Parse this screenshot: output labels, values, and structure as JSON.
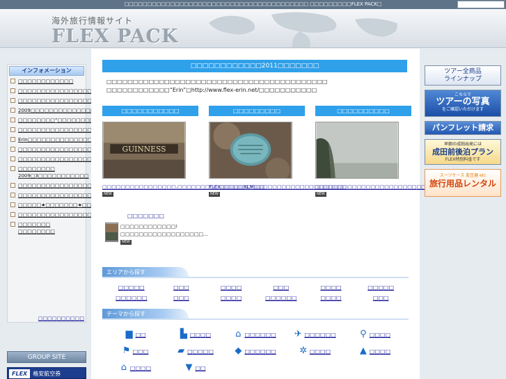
{
  "topbar": {
    "text": "□□□□□□□□□□□□□□□□□□□□□□□□□□□□□□□□□□□□□□□□ □□□□□□□□□FLEX PACK□"
  },
  "header": {
    "site_subtitle": "海外旅行情報サイト",
    "brand": "FLEX PACK"
  },
  "sidebar": {
    "title": "インフォメーション",
    "items": [
      "□□□□□□□□□□□□",
      "□□□□□□□□□□□□□□□□□□□□□□□□□□□□□□□□□VJF□□□□□",
      "□□□□□□□□□□□□□□□□",
      "2009□□□□□□□□□□□□□□□□□□",
      "□□□□□□□□“□□□□□□□□□□”□□□□",
      "□□□□□□□□□□□□□□□□□□□□□",
      "Erin□□□□□□□□□□□□□□□□",
      "□□□□□□□□□□□□□□□□",
      "□□□□□□□□□□□□□□□□□□□□□□□□□□□□□□□□□□□□□",
      "□□□□□□□□ 2009□3□□□□□□□□□□□",
      "□□□□□□□□□□□□□□□□□□□□□",
      "□□□□□□□□□□□□□□□□□□",
      "□□□□□★□□□□□□□★□□□□□□□□□□□2008□□□□",
      "□□□□□□□□□□□□□□□□□□□□",
      "□□□□□□□ □□□□□□□□"
    ],
    "more": "□□□□□□□□□□",
    "group_site": "GROUP SITE",
    "flex_logo": "FLEX",
    "flex_banner": "格安航空券"
  },
  "main": {
    "news_title": "□□□□□□□□□□□□2011□□□□□□□",
    "news_text": "□□□□□□□□□□□□□□□□□□□□□□□□□□□□□□□□□□□□□□□□□□ □□□□□□□□□□□□“Erin”□http://www.flex-erin.net/□□□□□□□□□□□",
    "cards": [
      {
        "head": "□□□□□□□□□□□",
        "text": "□□□□□□□□□□□□□□□□,□□□□□□□□□□□□□□□□□□□_",
        "badge": "NEW"
      },
      {
        "head": "□□□□□□□□□",
        "text": "FLEX□□□□□KLM□□□□□□□□□□□□□□□□□□□□_",
        "badge": "NEW"
      },
      {
        "head": "□□□□□□□□□□",
        "text": "□□□□□□□□□□□□□□□□□□□□□□□□□□□□□□□□□_",
        "badge": "NEW"
      }
    ],
    "mini_head": "□□□□□□□",
    "mini_text": "□□□□□□□□□□□□! □□□□□□□□□□□□□□□□□□...",
    "mini_badge": "NEW",
    "area_title": "エリアから探す",
    "areas": [
      "□□□□□",
      "□□□",
      "□□□□",
      "□□□",
      "□□□□",
      "□□□□□",
      "□□□□□□",
      "□□□",
      "□□□□",
      "□□□□□□",
      "□□□□",
      "□□□"
    ],
    "theme_title": "テーマから探す",
    "themes": [
      {
        "icon": "suitcase-icon",
        "glyph": "▆",
        "label": "□□"
      },
      {
        "icon": "city-icon",
        "glyph": "▙",
        "label": "□□□□"
      },
      {
        "icon": "house-icon",
        "glyph": "⌂",
        "label": "□□□□□□"
      },
      {
        "icon": "plane-icon",
        "glyph": "✈",
        "label": "□□□□□□"
      },
      {
        "icon": "dining-icon",
        "glyph": "⚲",
        "label": "□□□□"
      },
      {
        "icon": "shopping-icon",
        "glyph": "⚑",
        "label": "□□□"
      },
      {
        "icon": "elephant-icon",
        "glyph": "▰",
        "label": "□□□□□"
      },
      {
        "icon": "fish-icon",
        "glyph": "◆",
        "label": "□□□□□□"
      },
      {
        "icon": "esthe-icon",
        "glyph": "✲",
        "label": "□□□□"
      },
      {
        "icon": "mountain-icon",
        "glyph": "▲",
        "label": "□□□□"
      },
      {
        "icon": "church-icon",
        "glyph": "⌂",
        "label": "□□□□"
      },
      {
        "icon": "shirt-icon",
        "glyph": "▼",
        "label": "□□"
      }
    ]
  },
  "right": {
    "btn1_line1": "ツアー全商品",
    "btn1_line2": "ラインナップ",
    "btn2_small": "こちらで",
    "btn2_main": "ツアーの写真",
    "btn2_sub": "をご確認いただけます",
    "btn3": "パンフレット請求",
    "btn4_line1": "早朝の成田出発には",
    "btn4_main": "成田前後泊プラン",
    "btn4_line3": "FLEX特別料金です",
    "btn5_small": "スーツケース 変圧器 etc",
    "btn5_main": "旅行用品レンタル"
  }
}
